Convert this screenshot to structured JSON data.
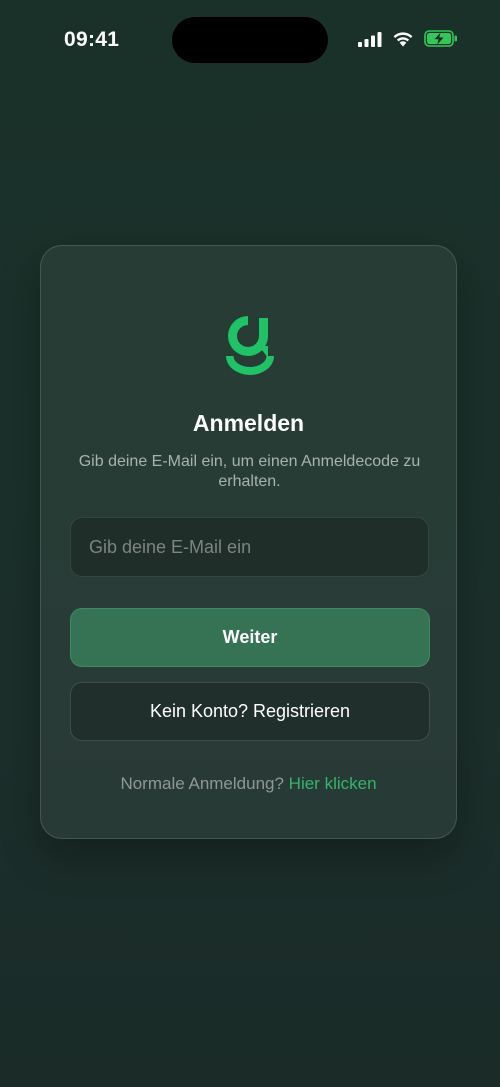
{
  "status_bar": {
    "time": "09:41",
    "icons": [
      "cellular-signal-icon",
      "wifi-icon",
      "battery-charging-icon"
    ],
    "battery_color": "#32c75a"
  },
  "login": {
    "logo": "brand-g-logo",
    "brand_color": "#1fc267",
    "title": "Anmelden",
    "subtitle": "Gib deine E-Mail ein, um einen Anmeldecode zu erhalten.",
    "email": {
      "value": "",
      "placeholder": "Gib deine E-Mail ein"
    },
    "continue_label": "Weiter",
    "register_label": "Kein Konto? Registrieren",
    "normal_login_prompt": "Normale Anmeldung?",
    "normal_login_link": "Hier klicken",
    "accent_color": "#357354",
    "link_color": "#35b46e"
  }
}
